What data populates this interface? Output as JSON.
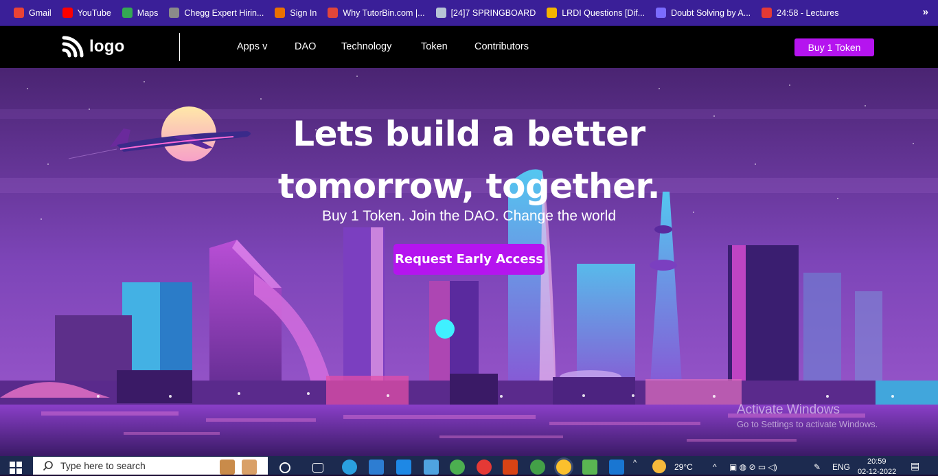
{
  "bookmarks": [
    {
      "label": "Gmail",
      "icon": "gmail-icon",
      "color": "#ea4335"
    },
    {
      "label": "YouTube",
      "icon": "youtube-icon",
      "color": "#ff0000"
    },
    {
      "label": "Maps",
      "icon": "maps-icon",
      "color": "#34a853"
    },
    {
      "label": "Chegg Expert Hirin...",
      "icon": "globe-icon",
      "color": "#8a8a8a"
    },
    {
      "label": "Sign In",
      "icon": "chegg-icon",
      "color": "#eb7100"
    },
    {
      "label": "Why TutorBin.com |...",
      "icon": "tutorbin-icon",
      "color": "#e2463a"
    },
    {
      "label": "[24]7 SPRINGBOARD",
      "icon": "springboard-icon",
      "color": "#b7c4d6"
    },
    {
      "label": "LRDI Questions [Dif...",
      "icon": "lrdi-icon",
      "color": "#f5b400"
    },
    {
      "label": "Doubt Solving by A...",
      "icon": "doubt-icon",
      "color": "#7b6cff"
    },
    {
      "label": "24:58 - Lectures",
      "icon": "check-icon",
      "color": "#e53935"
    }
  ],
  "bookmarks_more": "»",
  "nav": {
    "logo_text": "logo",
    "links": [
      "Apps v",
      "DAO",
      "Technology",
      "Token",
      "Contributors"
    ],
    "buy_button": "Buy 1 Token"
  },
  "hero": {
    "title_line1": "Lets build a better",
    "title_line2": "tomorrow, together.",
    "subtitle": "Buy 1 Token. Join the DAO. Change the world",
    "cta": "Request Early Access"
  },
  "watermark": {
    "line1": "Activate Windows",
    "line2": "Go to Settings to activate Windows."
  },
  "taskbar": {
    "search_placeholder": "Type here to search",
    "weather": "29°C",
    "language": "ENG",
    "time": "20:59",
    "date": "02-12-2022"
  },
  "colors": {
    "accent": "#b514ef",
    "bookmarks_bg": "#3a1f98",
    "nav_bg": "#000000"
  }
}
